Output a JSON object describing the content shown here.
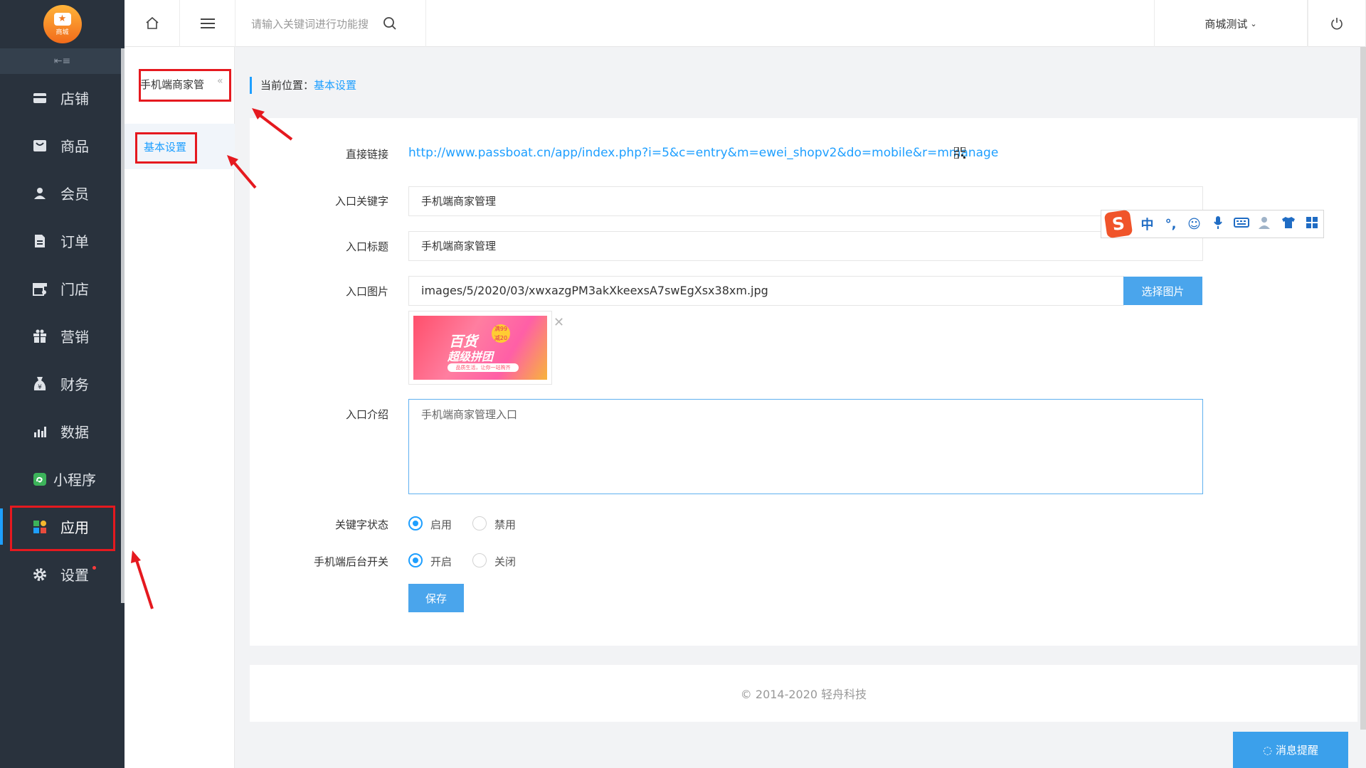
{
  "sidebar": {
    "logo_text": "商城",
    "items": [
      {
        "label": "店铺",
        "icon": "store-icon"
      },
      {
        "label": "商品",
        "icon": "goods-icon"
      },
      {
        "label": "会员",
        "icon": "member-icon"
      },
      {
        "label": "订单",
        "icon": "order-icon"
      },
      {
        "label": "门店",
        "icon": "shop-icon"
      },
      {
        "label": "营销",
        "icon": "gift-icon"
      },
      {
        "label": "财务",
        "icon": "money-bag-icon"
      },
      {
        "label": "数据",
        "icon": "bar-chart-icon"
      },
      {
        "label": "小程序",
        "icon": "mini-program-icon"
      },
      {
        "label": "应用",
        "icon": "apps-icon"
      },
      {
        "label": "设置",
        "icon": "gear-icon"
      }
    ],
    "active": "应用"
  },
  "submenu": {
    "title": "手机端商家管",
    "item": "基本设置"
  },
  "header": {
    "search_placeholder": "请输入关键词进行功能搜",
    "user_label": "商城测试"
  },
  "breadcrumb": {
    "prefix": "当前位置：",
    "current": "基本设置"
  },
  "form": {
    "direct_link_label": "直接链接",
    "direct_link": "http://www.passboat.cn/app/index.php?i=5&c=entry&m=ewei_shopv2&do=mobile&r=mmanage",
    "keyword_label": "入口关键字",
    "keyword_value": "手机端商家管理",
    "title_label": "入口标题",
    "title_value": "手机端商家管理",
    "image_label": "入口图片",
    "image_value": "images/5/2020/03/xwxazgPM3akXkeexsA7swEgXsx38xm.jpg",
    "choose_image_button": "选择图片",
    "intro_label": "入口介绍",
    "intro_value": "手机端商家管理入口",
    "keyword_status_label": "关键字状态",
    "keyword_status_options": [
      "启用",
      "禁用"
    ],
    "keyword_status_selected": "启用",
    "backend_switch_label": "手机端后台开关",
    "backend_switch_options": [
      "开启",
      "关闭"
    ],
    "backend_switch_selected": "开启",
    "save_button": "保存"
  },
  "thumbnail": {
    "line1": "百货",
    "line2": "超级拼团",
    "line3": "品质生活，让你一站购齐",
    "badge": "满99 减20"
  },
  "footer": {
    "copyright": "© 2014-2020 轻舟科技"
  },
  "message_button": "消息提醒",
  "ime": {
    "items": [
      "中",
      "°,",
      "☺",
      "mic",
      "keyboard",
      "user",
      "shirt",
      "grid"
    ]
  },
  "colors": {
    "sidebar_bg": "#29323d",
    "accent": "#1e9fff",
    "button_blue": "#4aa5ec",
    "highlight_red": "#e5191f"
  }
}
